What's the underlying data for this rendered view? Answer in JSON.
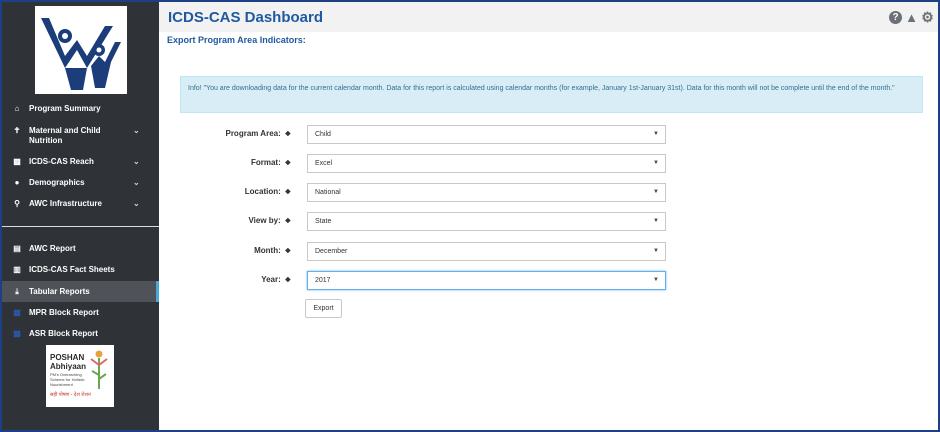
{
  "header": {
    "title": "ICDS-CAS Dashboard",
    "icons": [
      "help-icon",
      "warning-icon",
      "gear-icon"
    ]
  },
  "page": {
    "subtitle": "Export Program Area Indicators:"
  },
  "info_box": {
    "text": "Info! \"You are downloading data for the current calendar month. Data for this report is calculated using calendar months (for example, January 1st-January 31st). Data for this month will not be complete until the end of the month.\""
  },
  "sidebar": {
    "items": [
      {
        "label": "Program Summary",
        "icon": "home-icon"
      },
      {
        "label": "Maternal and Child Nutrition",
        "icon": "child-icon",
        "expandable": true
      },
      {
        "label": "ICDS-CAS Reach",
        "icon": "bar-chart-icon",
        "expandable": true
      },
      {
        "label": "Demographics",
        "icon": "users-icon",
        "expandable": true
      },
      {
        "label": "AWC Infrastructure",
        "icon": "map-pin-icon",
        "expandable": true
      }
    ],
    "reports": [
      {
        "label": "AWC Report",
        "icon": "report-icon"
      },
      {
        "label": "ICDS-CAS Fact Sheets",
        "icon": "document-icon"
      },
      {
        "label": "Tabular Reports",
        "icon": "download-icon",
        "active": true
      },
      {
        "label": "MPR Block Report",
        "icon": "block-report-icon"
      },
      {
        "label": "ASR Block Report",
        "icon": "block-report-icon"
      }
    ],
    "poshan": {
      "line1": "POSHAN",
      "line2": "Abhiyaan",
      "line3": "PM's Overarching Scheme for Holistic Nourishment",
      "line4": "सही पोषण - देश रोशन"
    }
  },
  "form": {
    "fields": [
      {
        "label": "Program Area:",
        "value": "Child"
      },
      {
        "label": "Format:",
        "value": "Excel"
      },
      {
        "label": "Location:",
        "value": "National"
      },
      {
        "label": "View by:",
        "value": "State"
      },
      {
        "label": "Month:",
        "value": "December"
      },
      {
        "label": "Year:",
        "value": "2017"
      }
    ],
    "export_label": "Export"
  },
  "colors": {
    "sidebar_bg": "#2f3338",
    "accent_blue": "#1f5aa0",
    "info_bg": "#d9edf7",
    "active_bar": "#45a9d4"
  }
}
